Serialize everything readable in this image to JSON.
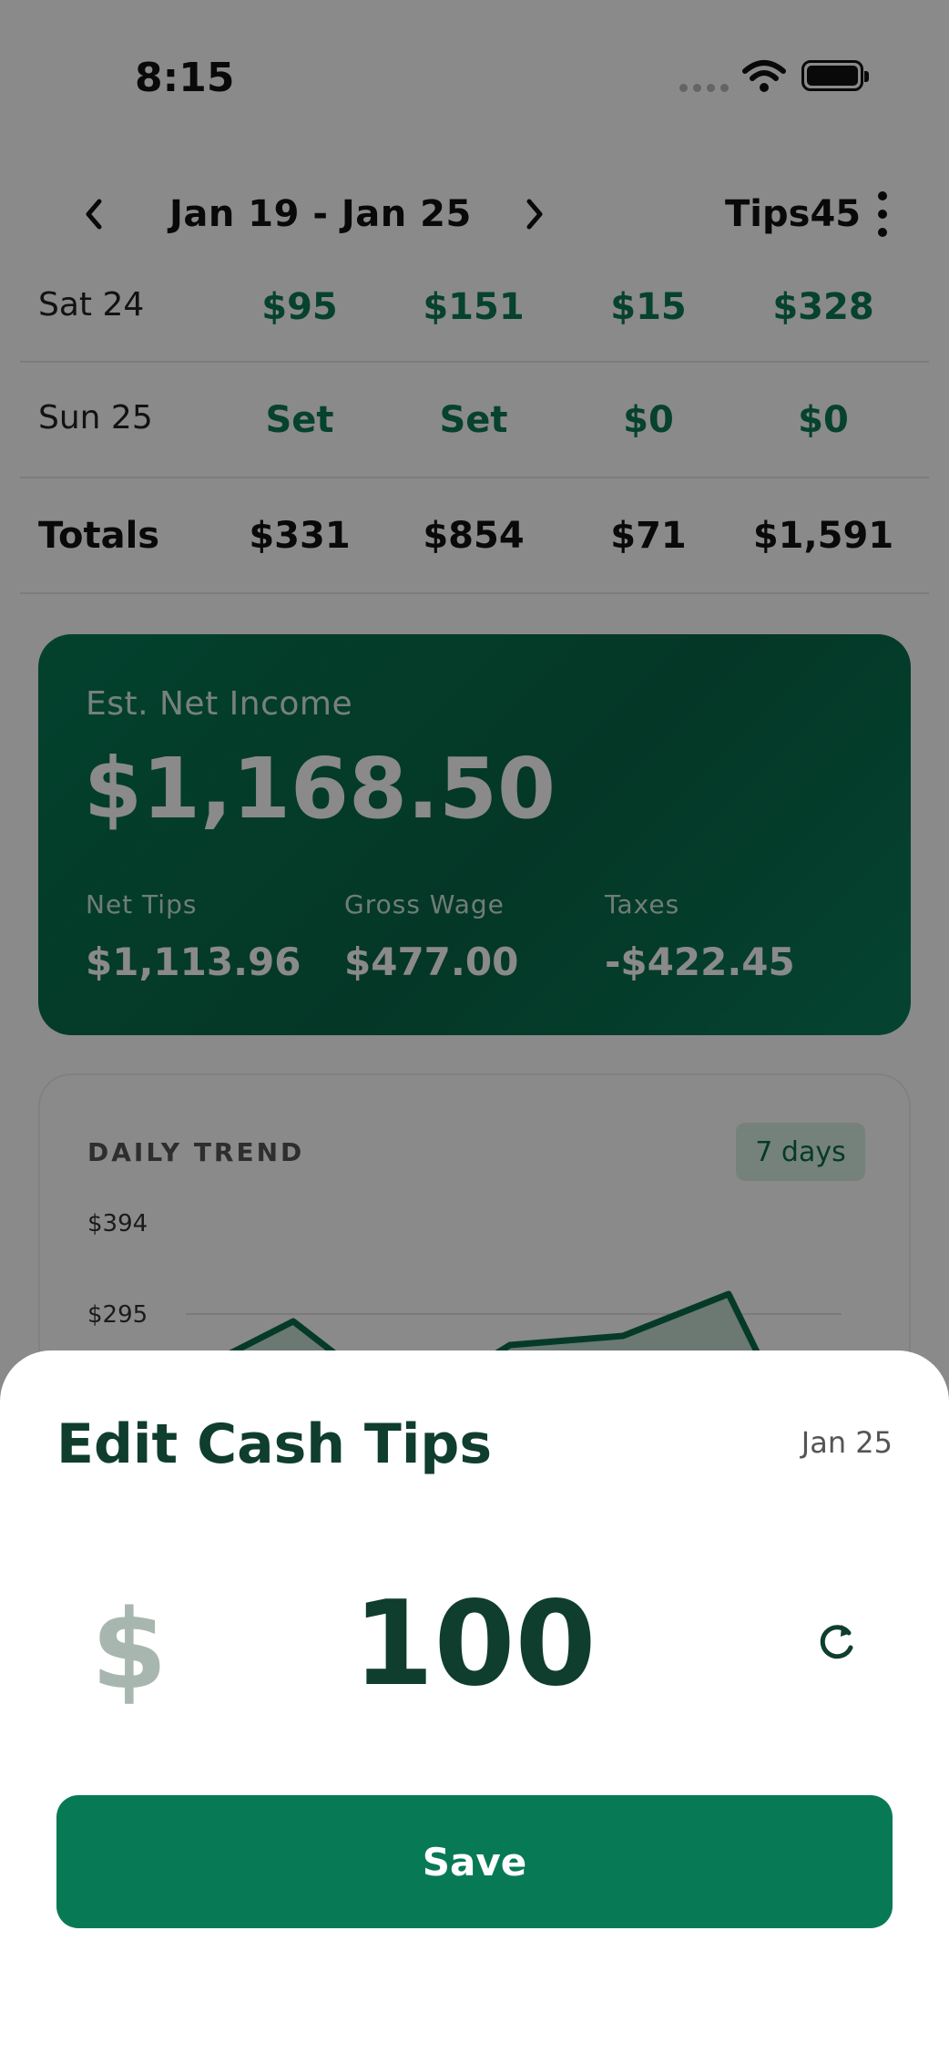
{
  "status": {
    "time": "8:15"
  },
  "header": {
    "date_range": "Jan 19 - Jan 25",
    "brand": "Tips45"
  },
  "table": {
    "rows": [
      {
        "day": "Sat 24",
        "values": [
          "$95",
          "$151",
          "$15",
          "$328"
        ]
      },
      {
        "day": "Sun 25",
        "values": [
          "Set",
          "Set",
          "$0",
          "$0"
        ]
      }
    ],
    "totals": {
      "label": "Totals",
      "values": [
        "$331",
        "$854",
        "$71",
        "$1,591"
      ]
    }
  },
  "income": {
    "label": "Est. Net Income",
    "value": "$1,168.50",
    "net_tips_label": "Net Tips",
    "net_tips": "$1,113.96",
    "gross_wage_label": "Gross Wage",
    "gross_wage": "$477.00",
    "taxes_label": "Taxes",
    "taxes": "-$422.45"
  },
  "trend": {
    "title": "DAILY TREND",
    "range": "7 days",
    "y_labels": [
      "$394",
      "$295"
    ]
  },
  "sheet": {
    "title": "Edit Cash Tips",
    "date": "Jan 25",
    "currency": "$",
    "amount": "100",
    "save_label": "Save"
  },
  "colors": {
    "accent": "#077a55",
    "dark_text": "#0f3d2e",
    "positive": "#0c7a55"
  },
  "icons": [
    "chevron-left-icon",
    "chevron-right-icon",
    "more-vertical-icon",
    "wifi-icon",
    "battery-icon",
    "refresh-icon"
  ]
}
